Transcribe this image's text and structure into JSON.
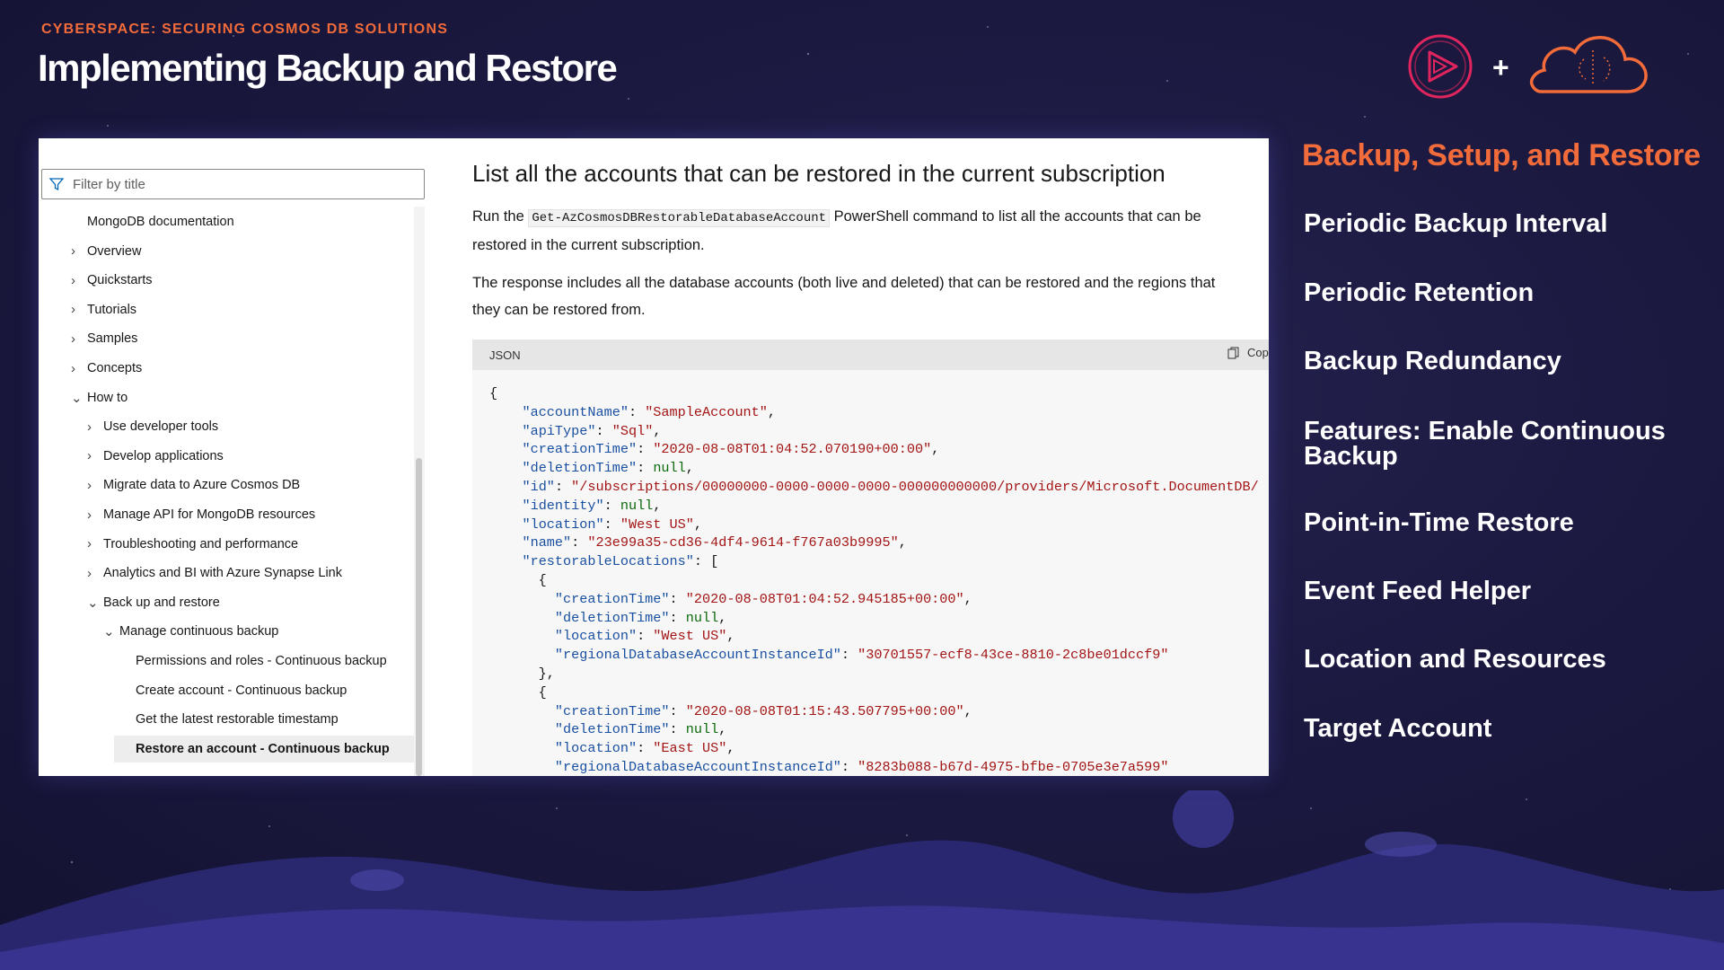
{
  "header": {
    "course_label": "CYBERSPACE: SECURING COSMOS DB SOLUTIONS",
    "title": "Implementing Backup and Restore",
    "logo_play_icon": "play-circle-icon",
    "logo_plus": "+",
    "logo_cloud_icon": "cloud-brain-icon"
  },
  "colors": {
    "accent": "#f26b3a",
    "background": "#1b1940",
    "active_toc": "#ededed"
  },
  "sidebar": {
    "filter_placeholder": "Filter by title",
    "items": [
      {
        "label": "MongoDB documentation",
        "chevron": ""
      },
      {
        "label": "Overview",
        "chevron": ">"
      },
      {
        "label": "Quickstarts",
        "chevron": ">"
      },
      {
        "label": "Tutorials",
        "chevron": ">"
      },
      {
        "label": "Samples",
        "chevron": ">"
      },
      {
        "label": "Concepts",
        "chevron": ">"
      },
      {
        "label": "How to",
        "chevron": "v"
      },
      {
        "label": "Use developer tools",
        "chevron": ">"
      },
      {
        "label": "Develop applications",
        "chevron": ">"
      },
      {
        "label": "Migrate data to Azure Cosmos DB",
        "chevron": ">"
      },
      {
        "label": "Manage API for MongoDB resources",
        "chevron": ">"
      },
      {
        "label": "Troubleshooting and performance",
        "chevron": ">"
      },
      {
        "label": "Analytics and BI with Azure Synapse Link",
        "chevron": ">"
      },
      {
        "label": "Back up and restore",
        "chevron": "v"
      },
      {
        "label": "Manage continuous backup",
        "chevron": "v"
      },
      {
        "label": "Permissions and roles - Continuous backup",
        "chevron": ""
      },
      {
        "label": "Create account - Continuous backup",
        "chevron": ""
      },
      {
        "label": "Get the latest restorable timestamp",
        "chevron": ""
      },
      {
        "label": "Restore an account - Continuous backup",
        "chevron": "",
        "active": true
      }
    ]
  },
  "content": {
    "heading": "List all the accounts that can be restored in the current subscription",
    "para1_before": "Run the ",
    "para1_code": "Get-AzCosmosDBRestorableDatabaseAccount",
    "para1_after": " PowerShell command to list all the accounts that can be",
    "para1_line2": "restored in the current subscription.",
    "para2_line1": "The response includes all the database accounts (both live and deleted) that can be restored and the regions that",
    "para2_line2": "they can be restored from.",
    "code_lang": "JSON",
    "copy_label": "Copy"
  },
  "code": {
    "open_brace": "{",
    "accountName_key": "\"accountName\"",
    "accountName_val": "\"SampleAccount\"",
    "apiType_key": "\"apiType\"",
    "apiType_val": "\"Sql\"",
    "creationTime_key": "\"creationTime\"",
    "creationTime_val": "\"2020-08-08T01:04:52.070190+00:00\"",
    "deletionTime_key": "\"deletionTime\"",
    "null": "null",
    "id_key": "\"id\"",
    "id_val": "\"/subscriptions/00000000-0000-0000-0000-000000000000/providers/Microsoft.DocumentDB/",
    "identity_key": "\"identity\"",
    "location_key": "\"location\"",
    "location_val": "\"West US\"",
    "name_key": "\"name\"",
    "name_val": "\"23e99a35-cd36-4df4-9614-f767a03b9995\"",
    "restorableLocations_key": "\"restorableLocations\"",
    "loc1_creation_val": "\"2020-08-08T01:04:52.945185+00:00\"",
    "loc1_location_val": "\"West US\"",
    "regionalId_key": "\"regionalDatabaseAccountInstanceId\"",
    "loc1_regional_val": "\"30701557-ecf8-43ce-8810-2c8be01dccf9\"",
    "loc2_creation_val": "\"2020-08-08T01:15:43.507795+00:00\"",
    "loc2_location_val": "\"East US\"",
    "loc2_regional_val": "\"8283b088-b67d-4975-bfbe-0705e3e7a599\""
  },
  "topics": {
    "title": "Backup, Setup, and Restore",
    "items": [
      "Periodic Backup Interval",
      "Periodic Retention",
      "Backup Redundancy",
      "Features: Enable Continuous Backup",
      "Point-in-Time Restore",
      "Event Feed Helper",
      "Location and Resources",
      "Target Account"
    ]
  }
}
